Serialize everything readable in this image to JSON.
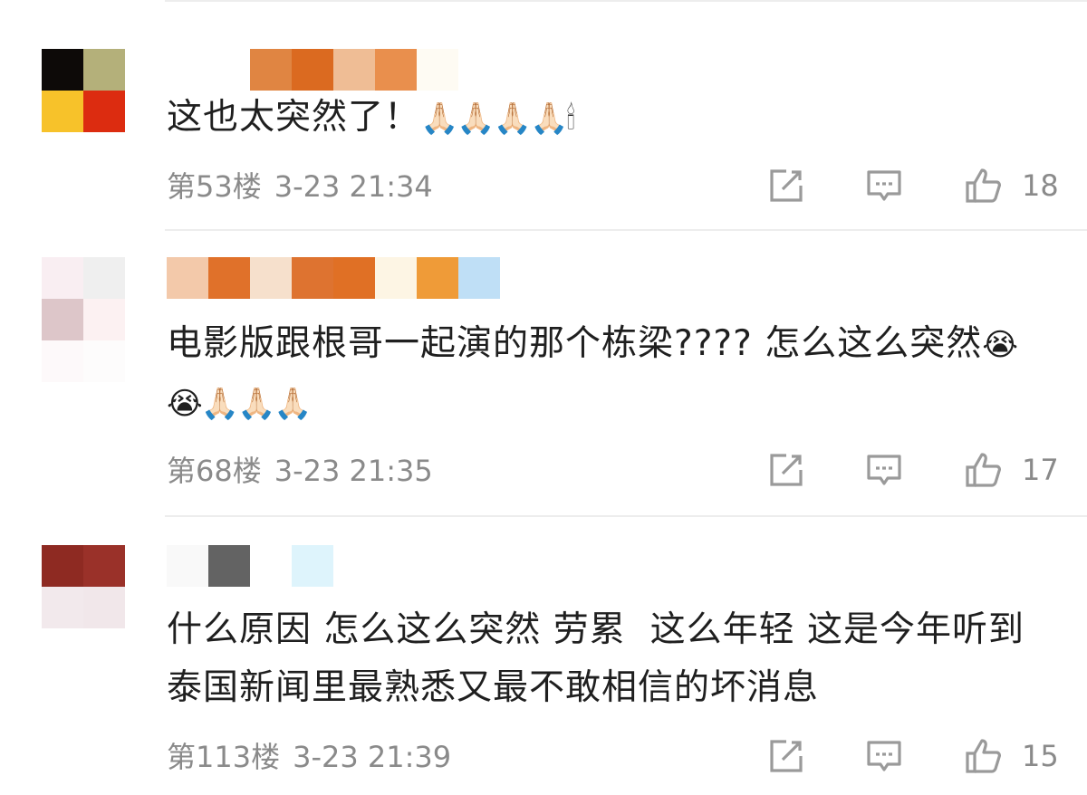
{
  "comments": [
    {
      "avatar_colors": [
        "#0d0a08",
        "#b4b07a",
        "#f7c22a",
        "#dc2c10"
      ],
      "name_colors": [
        "#ffffff",
        "#ffffff",
        "#e08542",
        "#db6a20",
        "#efbd95",
        "#e98f4d",
        "#fefbf3"
      ],
      "text": "这也太突然了！",
      "emoji": "🙏🏻🙏🏻🙏🏻🙏🏻🕯",
      "floor": "第53楼",
      "time": "3-23 21:34",
      "likes": "18"
    },
    {
      "avatar_colors": [
        "#f9eef2",
        "#efefef",
        "#ddc6c9",
        "#fcf1f2",
        "#fdf9fa",
        "#fdfcfc"
      ],
      "name_colors": [
        "#f3c9aa",
        "#e0712a",
        "#f6e0cc",
        "#de7330",
        "#e07025",
        "#fdf5e4",
        "#ef9b38",
        "#bfdff6"
      ],
      "text": "电影版跟根哥一起演的那个栋梁???? 怎么这么突然",
      "emoji": "😭😭🙏🏻🙏🏻🙏🏻",
      "floor": "第68楼",
      "time": "3-23 21:35",
      "likes": "17"
    },
    {
      "avatar_colors": [
        "#8e2a22",
        "#9a3129",
        "#f2e9ec",
        "#f1e7ea"
      ],
      "name_colors": [
        "#f9f9f9",
        "#636363",
        "#ffffff",
        "#def4fc"
      ],
      "text": "什么原因 怎么这么突然 劳累  这么年轻 这是今年听到泰国新闻里最熟悉又最不敢相信的坏消息",
      "emoji": "",
      "floor": "第113楼",
      "time": "3-23 21:39",
      "likes": "15"
    }
  ],
  "icons": {
    "repost": "share-edit-icon",
    "reply": "comment-icon",
    "like": "thumbs-up-icon"
  },
  "colors": {
    "meta": "#8a8a8a",
    "divider": "#ededed",
    "icon": "#9a9a9a"
  }
}
